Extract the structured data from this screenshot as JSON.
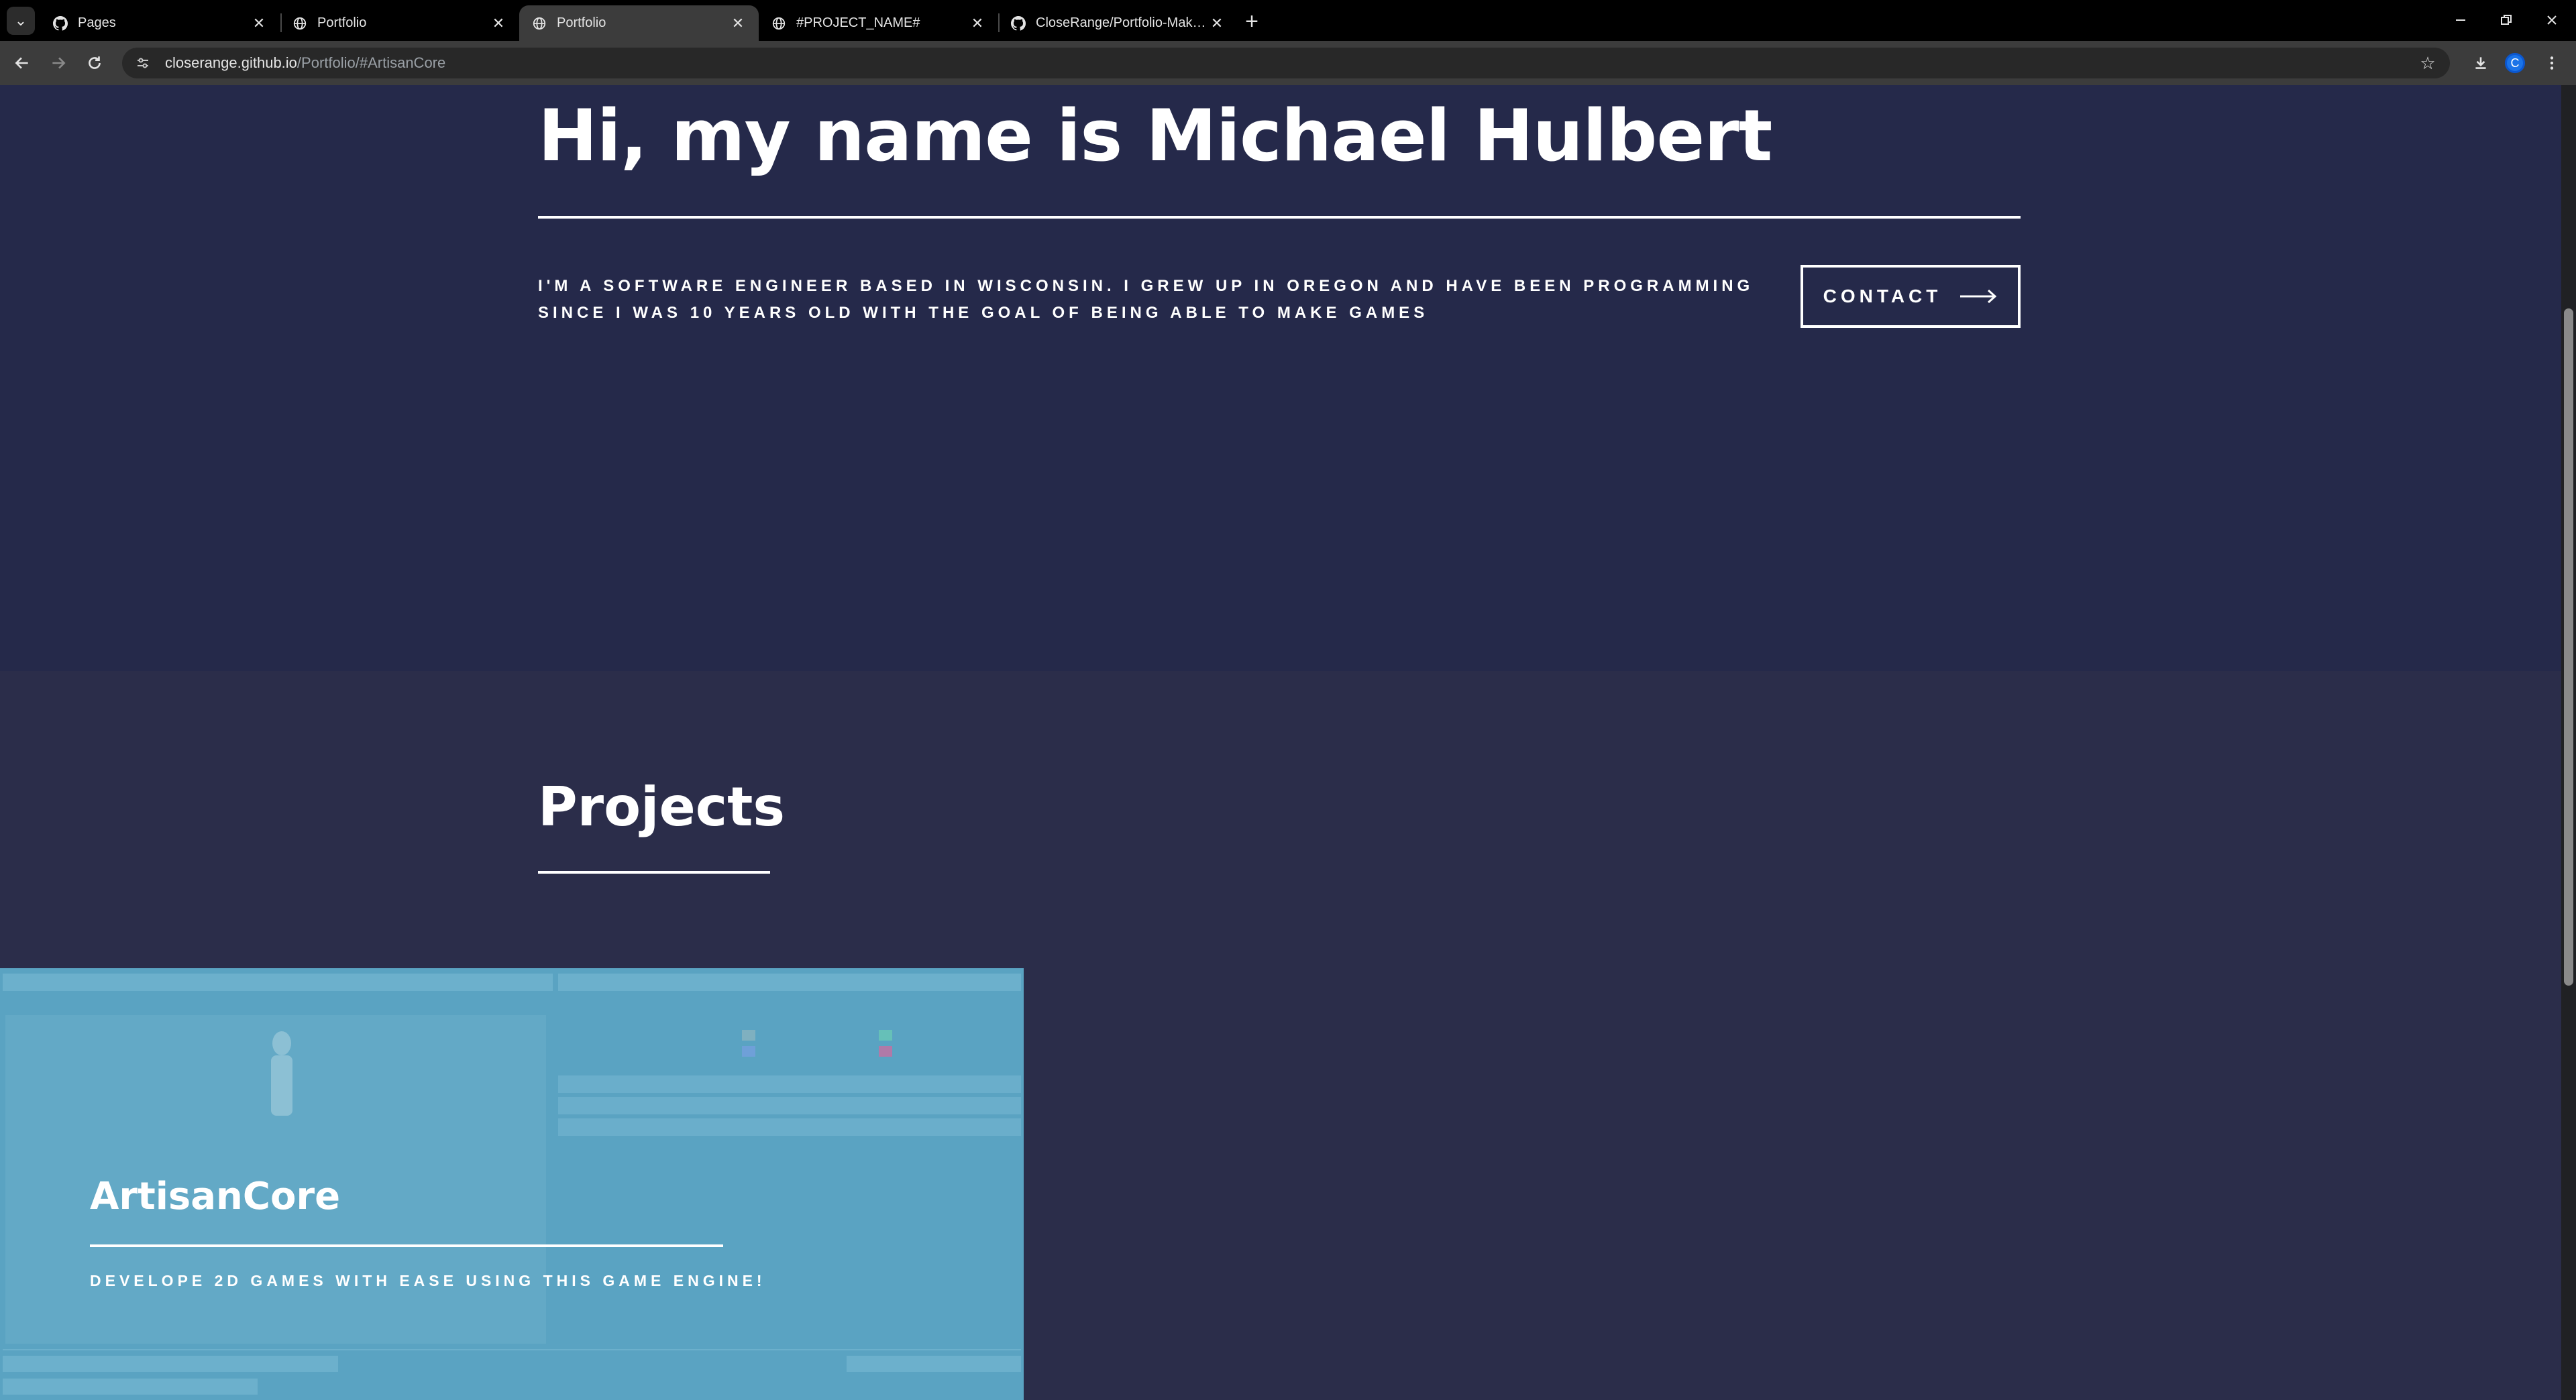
{
  "browser": {
    "tabs": [
      {
        "title": "Pages",
        "icon": "github-icon",
        "active": false
      },
      {
        "title": "Portfolio",
        "icon": "globe-icon",
        "active": false
      },
      {
        "title": "Portfolio",
        "icon": "globe-icon",
        "active": true
      },
      {
        "title": "#PROJECT_NAME#",
        "icon": "globe-icon",
        "active": false
      },
      {
        "title": "CloseRange/Portfolio-Maker: A",
        "icon": "github-icon",
        "active": false
      }
    ],
    "url_host": "closerange.github.io",
    "url_path": "/Portfolio/#ArtisanCore",
    "profile_initial": "C",
    "accent": "#1a73e8"
  },
  "hero": {
    "title": "Hi, my name is Michael Hulbert",
    "text": "I'm a software engineer based in Wisconsin. I grew up in Oregon and have been programming since I was 10 years old with the goal of being able to make games",
    "contact_label": "CONTACT",
    "background": "#25294a"
  },
  "projects": {
    "title": "Projects",
    "background": "#2b2d4a",
    "cards": [
      {
        "title": "ArtisanCore",
        "description": "Develope 2D games with ease using this game engine!",
        "overlay_color": "#5aa3c2"
      }
    ]
  }
}
